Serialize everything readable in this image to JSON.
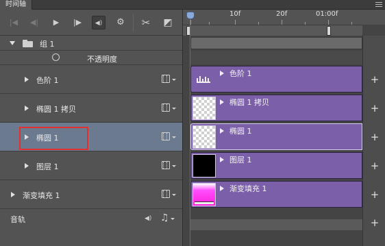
{
  "panel": {
    "tab_title": "时间轴"
  },
  "toolbar": {
    "first_frame": "|◀",
    "prev_frame": "◀|",
    "play": "▶",
    "next_frame": "|▶",
    "audio": "◀)",
    "settings": "⚙",
    "split": "✂",
    "transition": "◩"
  },
  "ruler": {
    "labels": [
      "10f",
      "20f",
      "01:00f"
    ]
  },
  "layers": [
    {
      "label": "组 1",
      "type": "group",
      "expanded": true
    },
    {
      "label": "不透明度",
      "type": "property"
    },
    {
      "label": "色阶 1",
      "type": "adjustment",
      "thumbnail": "levels-icon"
    },
    {
      "label": "椭圆 1 拷贝",
      "type": "shape",
      "thumbnail": "transparent"
    },
    {
      "label": "椭圆 1",
      "type": "shape",
      "thumbnail": "transparent",
      "selected": true
    },
    {
      "label": "图层 1",
      "type": "pixel",
      "thumbnail": "black"
    },
    {
      "label": "渐变填充 1",
      "type": "fill",
      "thumbnail": "gradient"
    }
  ],
  "audio": {
    "label": "音轨"
  },
  "colors": {
    "track_purple": "#7b5fa8",
    "playhead": "#e03a3a",
    "selection_outline": "#e03030",
    "selected_row": "#6b7a8f"
  }
}
